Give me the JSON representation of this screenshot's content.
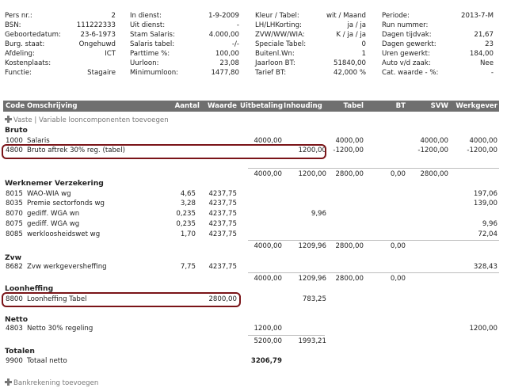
{
  "header": {
    "col1": [
      {
        "label": "Pers nr.:",
        "value": "2"
      },
      {
        "label": "BSN:",
        "value": "111222333"
      },
      {
        "label": "Geboortedatum:",
        "value": "23-6-1973"
      },
      {
        "label": "Burg. staat:",
        "value": "Ongehuwd"
      },
      {
        "label": "Afdeling:",
        "value": "ICT"
      },
      {
        "label": "Kostenplaats:",
        "value": ""
      },
      {
        "label": "Functie:",
        "value": "Stagaire"
      }
    ],
    "col2": [
      {
        "label": "In dienst:",
        "value": "1-9-2009"
      },
      {
        "label": "Uit dienst:",
        "value": "-"
      },
      {
        "label": "Stam Salaris:",
        "value": "4.000,00"
      },
      {
        "label": "Salaris tabel:",
        "value": "-/-"
      },
      {
        "label": "Parttime %:",
        "value": "100,00"
      },
      {
        "label": "Uurloon:",
        "value": "23,08"
      },
      {
        "label": "Minimumloon:",
        "value": "1477,80"
      }
    ],
    "col3": [
      {
        "label": "Kleur / Tabel:",
        "value": "wit / Maand"
      },
      {
        "label": "LH/LHKorting:",
        "value": "ja / ja"
      },
      {
        "label": "ZVW/WW/WIA:",
        "value": "K / ja / ja"
      },
      {
        "label": "Speciale Tabel:",
        "value": "0"
      },
      {
        "label": "Buitenl.Wn:",
        "value": "1"
      },
      {
        "label": "Jaarloon BT:",
        "value": "51840,00"
      },
      {
        "label": "Tarief BT:",
        "value": "42,000 %"
      }
    ],
    "col4": [
      {
        "label": "Periode:",
        "value": "2013-7-M"
      },
      {
        "label": "Run nummer:",
        "value": ""
      },
      {
        "label": "Dagen tijdvak:",
        "value": "21,67"
      },
      {
        "label": "Dagen gewerkt:",
        "value": "23"
      },
      {
        "label": "Uren gewerkt:",
        "value": "184,00"
      },
      {
        "label": "Auto v/d zaak:",
        "value": "Nee"
      },
      {
        "label": "Cat. waarde - %:",
        "value": "-"
      }
    ]
  },
  "table": {
    "columns": [
      "Code",
      "Omschrijving",
      "Aantal",
      "Waarde",
      "Uitbetaling",
      "Inhouding",
      "Tabel",
      "BT",
      "SVW",
      "Werkgever"
    ],
    "add_components_label": "Vaste | Variable looncomponenten toevoegen",
    "add_bank_label": "Bankrekening toevoegen",
    "sections": [
      {
        "title": "Bruto",
        "rows": [
          {
            "code": "1000",
            "desc": "Salaris",
            "aantal": "",
            "waarde": "",
            "uitbetaling": "4000,00",
            "inhouding": "",
            "tabel": "4000,00",
            "bt": "",
            "svw": "4000,00",
            "werkgever": "4000,00"
          },
          {
            "code": "4800",
            "desc": "Bruto aftrek 30% reg. (tabel)",
            "aantal": "",
            "waarde": "",
            "uitbetaling": "",
            "inhouding": "1200,00",
            "tabel": "-1200,00",
            "bt": "",
            "svw": "-1200,00",
            "werkgever": "-1200,00"
          }
        ],
        "subtotal": {
          "uitbetaling": "4000,00",
          "inhouding": "1200,00",
          "tabel": "2800,00",
          "bt": "0,00",
          "svw": "2800,00"
        }
      },
      {
        "title": "Werknemer Verzekering",
        "rows": [
          {
            "code": "8015",
            "desc": "WAO-WIA wg",
            "aantal": "4,65",
            "waarde": "4237,75",
            "uitbetaling": "",
            "inhouding": "",
            "tabel": "",
            "bt": "",
            "svw": "",
            "werkgever": "197,06"
          },
          {
            "code": "8035",
            "desc": "Premie sectorfonds wg",
            "aantal": "3,28",
            "waarde": "4237,75",
            "uitbetaling": "",
            "inhouding": "",
            "tabel": "",
            "bt": "",
            "svw": "",
            "werkgever": "139,00"
          },
          {
            "code": "8070",
            "desc": "gediff. WGA wn",
            "aantal": "0,235",
            "waarde": "4237,75",
            "uitbetaling": "",
            "inhouding": "9,96",
            "tabel": "",
            "bt": "",
            "svw": "",
            "werkgever": ""
          },
          {
            "code": "8075",
            "desc": "gediff. WGA wg",
            "aantal": "0,235",
            "waarde": "4237,75",
            "uitbetaling": "",
            "inhouding": "",
            "tabel": "",
            "bt": "",
            "svw": "",
            "werkgever": "9,96"
          },
          {
            "code": "8085",
            "desc": "werkloosheidswet wg",
            "aantal": "1,70",
            "waarde": "4237,75",
            "uitbetaling": "",
            "inhouding": "",
            "tabel": "",
            "bt": "",
            "svw": "",
            "werkgever": "72,04"
          }
        ],
        "subtotal": {
          "uitbetaling": "4000,00",
          "inhouding": "1209,96",
          "tabel": "2800,00",
          "bt": "0,00",
          "svw": ""
        }
      },
      {
        "title": "Zvw",
        "rows": [
          {
            "code": "8682",
            "desc": "Zvw werkgeversheffing",
            "aantal": "7,75",
            "waarde": "4237,75",
            "uitbetaling": "",
            "inhouding": "",
            "tabel": "",
            "bt": "",
            "svw": "",
            "werkgever": "328,43"
          }
        ],
        "subtotal": {
          "uitbetaling": "4000,00",
          "inhouding": "1209,96",
          "tabel": "2800,00",
          "bt": "0,00",
          "svw": ""
        }
      },
      {
        "title": "Loonheffing",
        "rows": [
          {
            "code": "8800",
            "desc": "Loonheffing Tabel",
            "aantal": "",
            "waarde": "2800,00",
            "uitbetaling": "",
            "inhouding": "783,25",
            "tabel": "",
            "bt": "",
            "svw": "",
            "werkgever": ""
          }
        ]
      },
      {
        "title": "Netto",
        "rows": [
          {
            "code": "4803",
            "desc": "Netto 30% regeling",
            "aantal": "",
            "waarde": "",
            "uitbetaling": "1200,00",
            "inhouding": "",
            "tabel": "",
            "bt": "",
            "svw": "",
            "werkgever": "1200,00"
          }
        ],
        "subtotal": {
          "uitbetaling": "5200,00",
          "inhouding": "1993,21",
          "tabel": "",
          "bt": "",
          "svw": ""
        }
      },
      {
        "title": "Totalen",
        "rows": [
          {
            "code": "9900",
            "desc": "Totaal netto",
            "aantal": "",
            "waarde": "",
            "uitbetaling": "3206,79",
            "inhouding": "",
            "tabel": "",
            "bt": "",
            "svw": "",
            "werkgever": ""
          }
        ]
      }
    ]
  },
  "colors": {
    "header_bg": "#6f6f6f",
    "highlight": "#7a1418",
    "divider": "#bdbdbd"
  }
}
